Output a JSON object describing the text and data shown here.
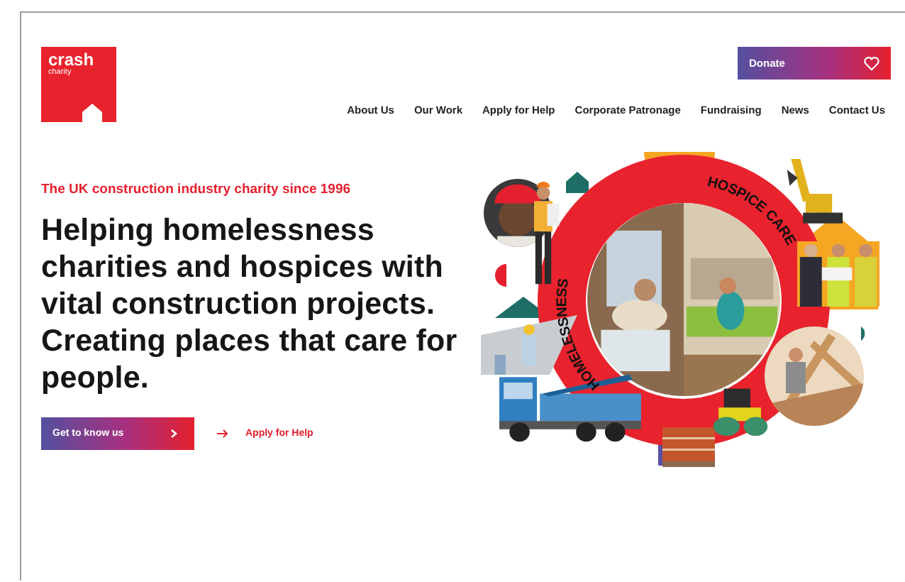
{
  "logo": {
    "name": "crash",
    "subtitle": "charity"
  },
  "donate_button": {
    "label": "Donate"
  },
  "nav": [
    {
      "label": "About Us"
    },
    {
      "label": "Our Work"
    },
    {
      "label": "Apply for Help"
    },
    {
      "label": "Corporate Patronage"
    },
    {
      "label": "Fundraising"
    },
    {
      "label": "News"
    },
    {
      "label": "Contact Us"
    }
  ],
  "hero": {
    "tagline": "The UK construction industry charity since 1996",
    "heading": "Helping homelessness charities and hospices with vital construction projects. Creating places that care for people.",
    "primary_button": "Get to know us",
    "secondary_link": "Apply for Help"
  },
  "collage": {
    "ring_labels": [
      "HOMELESSNESS",
      "HOSPICE CARE"
    ]
  }
}
